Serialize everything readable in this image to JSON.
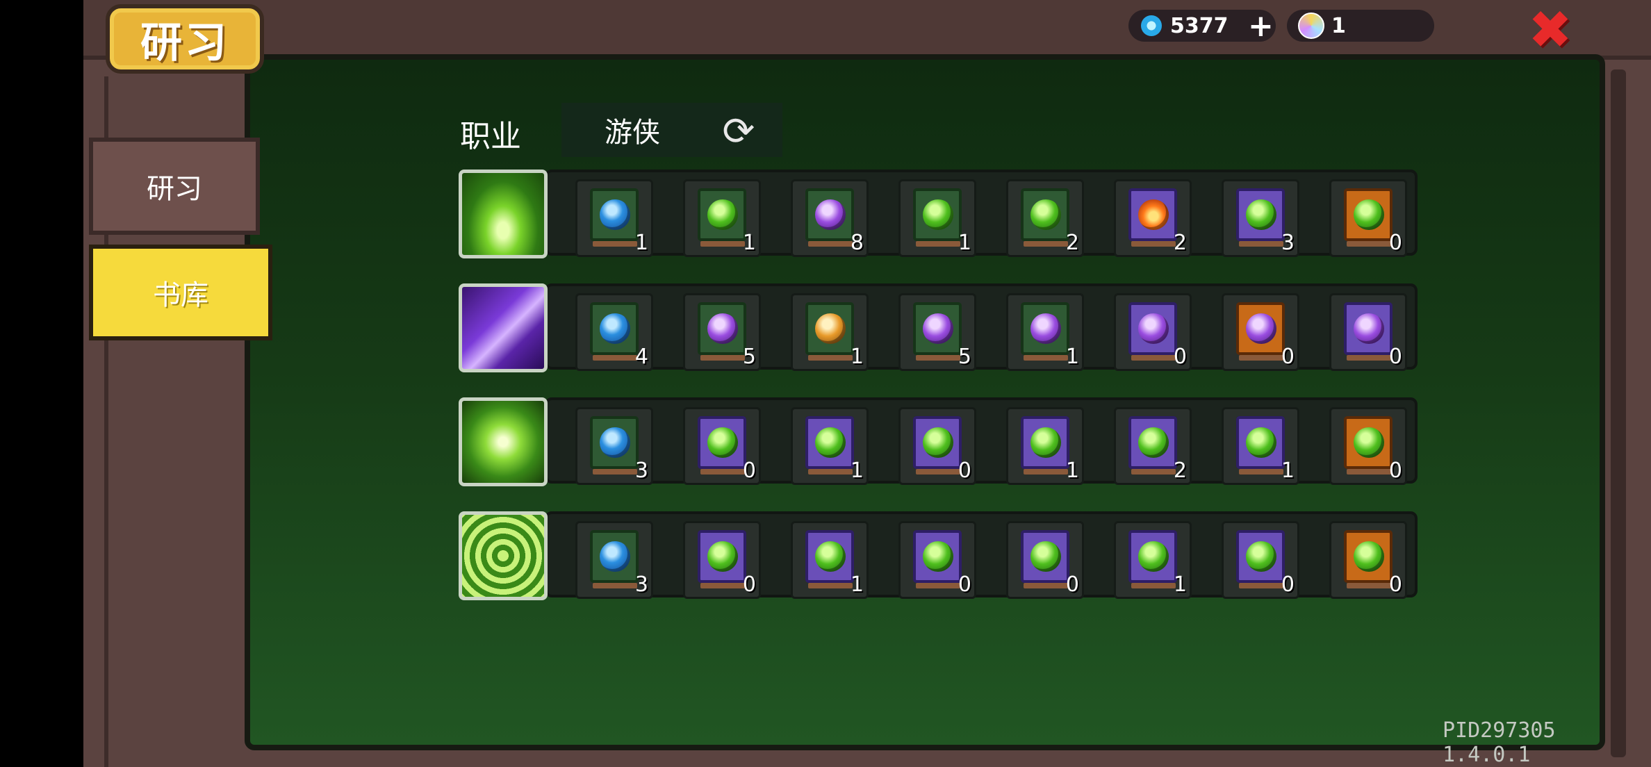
{
  "header": {
    "title": "研习",
    "gems": "5377",
    "crystals": "1"
  },
  "sidebar": {
    "tabs": [
      {
        "label": "研习",
        "selected": false
      },
      {
        "label": "书库",
        "selected": true
      }
    ]
  },
  "class_selector": {
    "label": "职业",
    "value": "游侠"
  },
  "rows": [
    {
      "class_icon": "green-burst",
      "slots": [
        {
          "orb": "blue",
          "frame": "green",
          "count": "1"
        },
        {
          "orb": "green",
          "frame": "green",
          "count": "1"
        },
        {
          "orb": "purple",
          "frame": "green",
          "count": "8"
        },
        {
          "orb": "green",
          "frame": "green",
          "count": "1"
        },
        {
          "orb": "green",
          "frame": "green",
          "count": "2"
        },
        {
          "orb": "fire",
          "frame": "purple",
          "count": "2"
        },
        {
          "orb": "green",
          "frame": "purple",
          "count": "3"
        },
        {
          "orb": "green",
          "frame": "orange",
          "count": "0"
        }
      ]
    },
    {
      "class_icon": "purple-slash",
      "slots": [
        {
          "orb": "blue",
          "frame": "green",
          "count": "4"
        },
        {
          "orb": "purple",
          "frame": "green",
          "count": "5"
        },
        {
          "orb": "orange",
          "frame": "green",
          "count": "1"
        },
        {
          "orb": "purple",
          "frame": "green",
          "count": "5"
        },
        {
          "orb": "purple",
          "frame": "green",
          "count": "1"
        },
        {
          "orb": "purple",
          "frame": "purple",
          "count": "0"
        },
        {
          "orb": "purple",
          "frame": "orange",
          "count": "0"
        },
        {
          "orb": "purple",
          "frame": "purple",
          "count": "0"
        }
      ]
    },
    {
      "class_icon": "green-lightning",
      "slots": [
        {
          "orb": "blue",
          "frame": "green",
          "count": "3"
        },
        {
          "orb": "green",
          "frame": "purple",
          "count": "0"
        },
        {
          "orb": "green",
          "frame": "purple",
          "count": "1"
        },
        {
          "orb": "green",
          "frame": "purple",
          "count": "0"
        },
        {
          "orb": "green",
          "frame": "purple",
          "count": "1"
        },
        {
          "orb": "green",
          "frame": "purple",
          "count": "2"
        },
        {
          "orb": "green",
          "frame": "purple",
          "count": "1"
        },
        {
          "orb": "green",
          "frame": "orange",
          "count": "0"
        }
      ]
    },
    {
      "class_icon": "green-spiral",
      "slots": [
        {
          "orb": "blue",
          "frame": "green",
          "count": "3"
        },
        {
          "orb": "green",
          "frame": "purple",
          "count": "0"
        },
        {
          "orb": "green",
          "frame": "purple",
          "count": "1"
        },
        {
          "orb": "green",
          "frame": "purple",
          "count": "0"
        },
        {
          "orb": "green",
          "frame": "purple",
          "count": "0"
        },
        {
          "orb": "green",
          "frame": "purple",
          "count": "1"
        },
        {
          "orb": "green",
          "frame": "purple",
          "count": "0"
        },
        {
          "orb": "green",
          "frame": "orange",
          "count": "0"
        }
      ]
    }
  ],
  "footer": {
    "version": "PID297305 1.4.0.1"
  },
  "colors": {
    "accent_yellow": "#f6da3c",
    "close_red": "#e82a2a",
    "panel_green": "#163a16"
  }
}
